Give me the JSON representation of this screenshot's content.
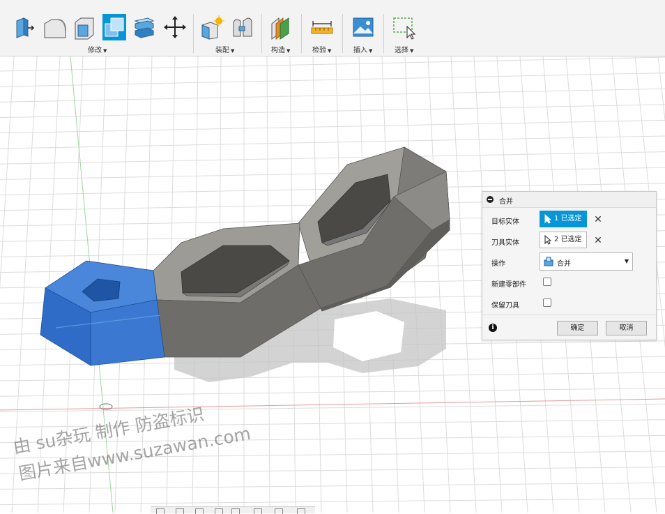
{
  "toolbar": {
    "groups": {
      "modify": "修改",
      "assemble": "装配",
      "construct": "构造",
      "inspect": "检验",
      "insert": "插入",
      "select": "选择"
    },
    "tools": [
      "press-pull-icon",
      "fillet-icon",
      "shell-icon",
      "combine-icon",
      "split-body-icon",
      "move-icon",
      "new-component-icon",
      "joint-icon",
      "offset-plane-icon",
      "measure-icon",
      "insert-image-icon",
      "select-box-icon"
    ],
    "active_tool": "combine-icon"
  },
  "panel": {
    "title": "合并",
    "target_label": "目标实体",
    "target_value": "1 已选定",
    "tool_label": "刀具实体",
    "tool_value": "2 已选定",
    "operation_label": "操作",
    "operation_value": "合并",
    "new_component_label": "新建零部件",
    "keep_tools_label": "保留刀具",
    "ok": "确定",
    "cancel": "取消",
    "clear_symbol": "✕",
    "info_symbol": "i"
  },
  "watermark": {
    "line1": "由 su杂玩 制作 防盗标识",
    "line2": "图片来自www.suzawan.com"
  },
  "colors": {
    "accent": "#0696d7",
    "selected_body": "#3a78d2",
    "body_gray": "#8a8985",
    "grid": "#dcdcdc",
    "x_axis": "#e79a9a",
    "y_axis": "#9ed49e"
  }
}
